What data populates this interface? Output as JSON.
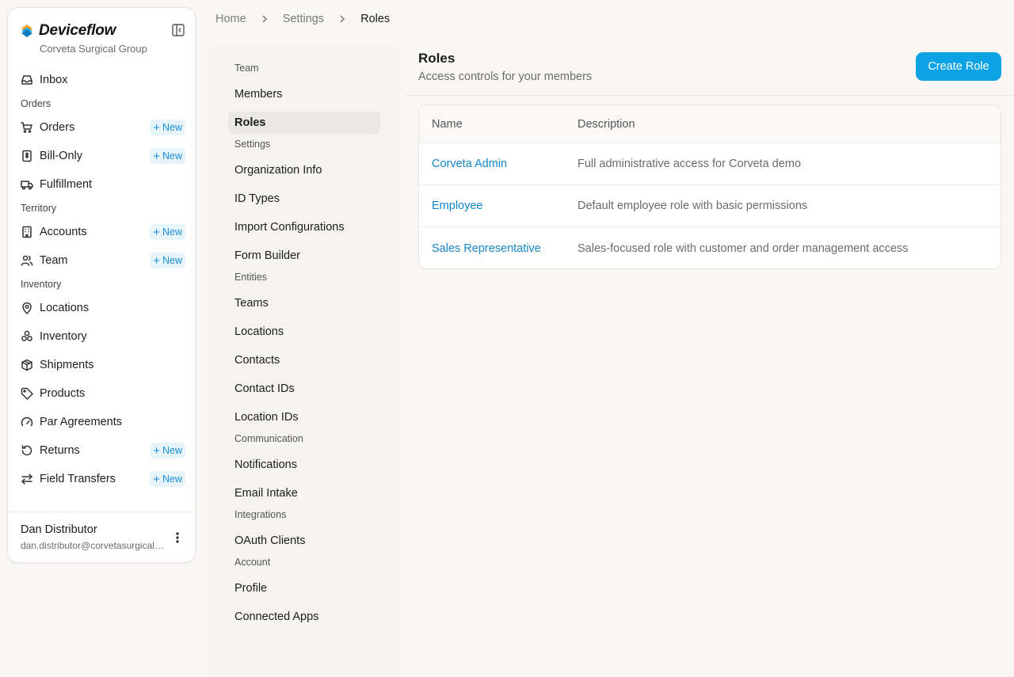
{
  "brand": {
    "name": "Deviceflow",
    "org": "Corveta Surgical Group"
  },
  "nav": [
    {
      "type": "item",
      "label": "Inbox",
      "icon": "inbox-icon"
    },
    {
      "type": "section",
      "label": "Orders"
    },
    {
      "type": "item",
      "label": "Orders",
      "icon": "cart-icon",
      "badge": "New"
    },
    {
      "type": "item",
      "label": "Bill-Only",
      "icon": "receipt-icon",
      "badge": "New"
    },
    {
      "type": "item",
      "label": "Fulfillment",
      "icon": "truck-icon"
    },
    {
      "type": "section",
      "label": "Territory"
    },
    {
      "type": "item",
      "label": "Accounts",
      "icon": "building-icon",
      "badge": "New"
    },
    {
      "type": "item",
      "label": "Team",
      "icon": "users-icon",
      "badge": "New"
    },
    {
      "type": "section",
      "label": "Inventory"
    },
    {
      "type": "item",
      "label": "Locations",
      "icon": "map-pin-icon"
    },
    {
      "type": "item",
      "label": "Inventory",
      "icon": "boxes-icon"
    },
    {
      "type": "item",
      "label": "Shipments",
      "icon": "package-icon"
    },
    {
      "type": "item",
      "label": "Products",
      "icon": "tag-icon"
    },
    {
      "type": "item",
      "label": "Par Agreements",
      "icon": "gauge-icon"
    },
    {
      "type": "item",
      "label": "Returns",
      "icon": "rotate-icon",
      "badge": "New"
    },
    {
      "type": "item",
      "label": "Field Transfers",
      "icon": "arrows-icon",
      "badge": "New"
    }
  ],
  "user": {
    "name": "Dan Distributor",
    "email": "dan.distributor@corvetasurgical.com"
  },
  "breadcrumb": [
    "Home",
    "Settings",
    "Roles"
  ],
  "settings_nav": [
    {
      "type": "section",
      "label": "Team"
    },
    {
      "type": "item",
      "label": "Members"
    },
    {
      "type": "item",
      "label": "Roles",
      "active": true
    },
    {
      "type": "section",
      "label": "Settings"
    },
    {
      "type": "item",
      "label": "Organization Info"
    },
    {
      "type": "item",
      "label": "ID Types"
    },
    {
      "type": "item",
      "label": "Import Configurations"
    },
    {
      "type": "item",
      "label": "Form Builder"
    },
    {
      "type": "section",
      "label": "Entities"
    },
    {
      "type": "item",
      "label": "Teams"
    },
    {
      "type": "item",
      "label": "Locations"
    },
    {
      "type": "item",
      "label": "Contacts"
    },
    {
      "type": "item",
      "label": "Contact IDs"
    },
    {
      "type": "item",
      "label": "Location IDs"
    },
    {
      "type": "section",
      "label": "Communication"
    },
    {
      "type": "item",
      "label": "Notifications"
    },
    {
      "type": "item",
      "label": "Email Intake"
    },
    {
      "type": "section",
      "label": "Integrations"
    },
    {
      "type": "item",
      "label": "OAuth Clients"
    },
    {
      "type": "section",
      "label": "Account"
    },
    {
      "type": "item",
      "label": "Profile"
    },
    {
      "type": "item",
      "label": "Connected Apps"
    }
  ],
  "page": {
    "title": "Roles",
    "subtitle": "Access controls for your members",
    "create_label": "Create Role"
  },
  "table": {
    "columns": [
      "Name",
      "Description"
    ],
    "rows": [
      {
        "name": "Corveta Admin",
        "description": "Full administrative access for Corveta demo"
      },
      {
        "name": "Employee",
        "description": "Default employee role with basic permissions"
      },
      {
        "name": "Sales Representative",
        "description": "Sales-focused role with customer and order management access"
      }
    ]
  },
  "colors": {
    "accent": "#0ba3e3",
    "link": "#1586c9",
    "badge_bg": "#e8f4fb",
    "background": "#f8f7f4"
  }
}
